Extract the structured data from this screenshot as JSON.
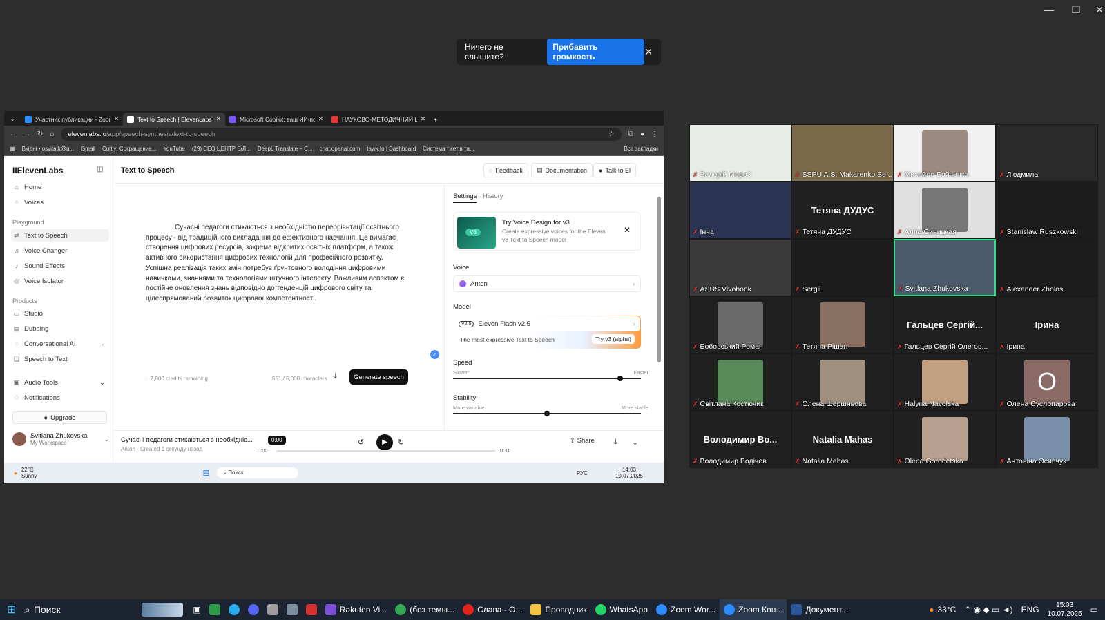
{
  "notification": {
    "text": "Ничего не слышите?",
    "button": "Прибавить громкость"
  },
  "tabs": [
    {
      "label": "Участник публикации - Zoom",
      "color": "#2d8cff"
    },
    {
      "label": "Text to Speech | ElevenLabs",
      "color": "#ffffff"
    },
    {
      "label": "Microsoft Copilot: ваш ИИ-пом",
      "color": "#7a5af8"
    },
    {
      "label": "НАУКОВО-МЕТОДИЧНИЙ ЦЕ",
      "color": "#e53935"
    }
  ],
  "address": {
    "domain": "elevenlabs.io",
    "path": "/app/speech-synthesis/text-to-speech"
  },
  "bookmarks": [
    "Вхідні • osvitatk@u...",
    "Gmail",
    "Cuttly: Сокращение...",
    "YouTube",
    "(29) СЕО ЦЕНТР Е/Л...",
    "DeepL Translate – С...",
    "chat.openai.com",
    "tawk.to | Dashboard",
    "Система тікетів та...",
    "Все закладки"
  ],
  "sidebar": {
    "logo": "IIElevenLabs",
    "items": [
      {
        "label": "Home",
        "icon": "⌂"
      },
      {
        "label": "Voices",
        "icon": "⁘"
      },
      {
        "label": "Text to Speech",
        "icon": "⇌"
      },
      {
        "label": "Voice Changer",
        "icon": "♫"
      },
      {
        "label": "Sound Effects",
        "icon": "♪"
      },
      {
        "label": "Voice Isolator",
        "icon": "◎"
      },
      {
        "label": "Studio",
        "icon": "▭"
      },
      {
        "label": "Dubbing",
        "icon": "▤"
      },
      {
        "label": "Conversational AI",
        "icon": "◌"
      },
      {
        "label": "Speech to Text",
        "icon": "❑"
      },
      {
        "label": "Audio Tools",
        "icon": "▣"
      },
      {
        "label": "Notifications",
        "icon": "♢"
      }
    ],
    "section_playground": "Playground",
    "section_products": "Products",
    "upgrade": "Upgrade",
    "user_name": "Svitlana Zhukovska",
    "workspace": "My Workspace"
  },
  "main": {
    "title": "Text to Speech",
    "feedback": "Feedback",
    "documentation": "Documentation",
    "talk": "Talk to El",
    "text": "Сучасні педагоги стикаються з необхідністю переорієнтації освітнього процесу - від традиційного викладання до ефективного навчання. Це вимагає створення цифрових ресурсів, зокрема відкритих освітніх платформ, а також активного використання цифрових технологій для професійного розвитку. Успішна реалізація таких змін потребує ґрунтовного володіння цифровими навичками, знаннями та технологіями штучного інтелекту. Важливим аспектом є постійне оновлення знань відповідно до тенденцій цифрового світу та цілеспрямований розвиток цифрової компетентності.",
    "credits": "7,900 credits remaining",
    "chars": "551 / 5,000 characters",
    "generate": "Generate speech"
  },
  "settings": {
    "tab_settings": "Settings",
    "tab_history": "History",
    "promo_badge": "V3",
    "promo_title": "Try Voice Design for v3",
    "promo_desc": "Create expressive voices for the Eleven v3 Text to Speech model",
    "voice_label": "Voice",
    "voice": "Anton",
    "model_label": "Model",
    "model_badge": "V2.5",
    "model": "Eleven Flash v2.5",
    "model_sub": "The most expressive Text to Speech",
    "model_try": "Try v3 (alpha)",
    "speed_label": "Speed",
    "speed_min": "Slower",
    "speed_max": "Faster",
    "speed_value": 0.89,
    "stability_label": "Stability",
    "stability_min": "More variable",
    "stability_max": "More stable",
    "stability_value": 0.5
  },
  "player": {
    "title": "Сучасні педагоги стикаються з необхідніс...",
    "voice": "Anton",
    "meta": "Created 1 секунду назад",
    "current": "0:00",
    "start": "0:00",
    "end": "0:31",
    "share": "Share"
  },
  "inner_taskbar": {
    "weather_temp": "22°C",
    "weather_desc": "Sunny",
    "search": "Поиск",
    "lang": "РУС",
    "time": "14:03",
    "date": "10.07.2025"
  },
  "participants": [
    {
      "name": "Валерій Моро3",
      "label": ""
    },
    {
      "name": "SSPU A.S. Makarenko Se...",
      "label": ""
    },
    {
      "name": "Михайло Бойченко",
      "label": ""
    },
    {
      "name": "Людмила",
      "label": ""
    },
    {
      "name": "Інна",
      "label": ""
    },
    {
      "name": "Тетяна ДУДУС",
      "label": "Тетяна ДУДУС"
    },
    {
      "name": "Алла Синицкая",
      "label": ""
    },
    {
      "name": "Stanislaw Ruszkowski",
      "label": ""
    },
    {
      "name": "ASUS Vivobook",
      "label": ""
    },
    {
      "name": "Sergii",
      "label": ""
    },
    {
      "name": "Svitlana Zhukovska",
      "label": ""
    },
    {
      "name": "Alexander Zholos",
      "label": ""
    },
    {
      "name": "Бобовський Роман",
      "label": ""
    },
    {
      "name": "Тетяна Рішан",
      "label": ""
    },
    {
      "name": "Гальцев Сергій Олегов...",
      "label": "Гальцев Сергій..."
    },
    {
      "name": "Ірина",
      "label": "Ірина"
    },
    {
      "name": "Світлана Костючик",
      "label": ""
    },
    {
      "name": "Олена Шершньова",
      "label": ""
    },
    {
      "name": "Halyna Navolska",
      "label": ""
    },
    {
      "name": "Олена Суслопарова",
      "label": ""
    },
    {
      "name": "Володимир Водічев",
      "label": "Володимир Во..."
    },
    {
      "name": "Natalia Mahas",
      "label": "Natalia Mahas"
    },
    {
      "name": "Olena Gorodetska",
      "label": ""
    },
    {
      "name": "Антоніна Осипчук",
      "label": ""
    }
  ],
  "taskbar": {
    "search": "Поиск",
    "apps": [
      "Rakuten Vi...",
      "(без темы...",
      "Слава - О...",
      "Проводник",
      "WhatsApp",
      "Zoom Wor...",
      "Zoom Кон...",
      "Документ..."
    ],
    "temp": "33°C",
    "lang": "ENG",
    "time": "15:03",
    "date": "10.07.2025"
  }
}
